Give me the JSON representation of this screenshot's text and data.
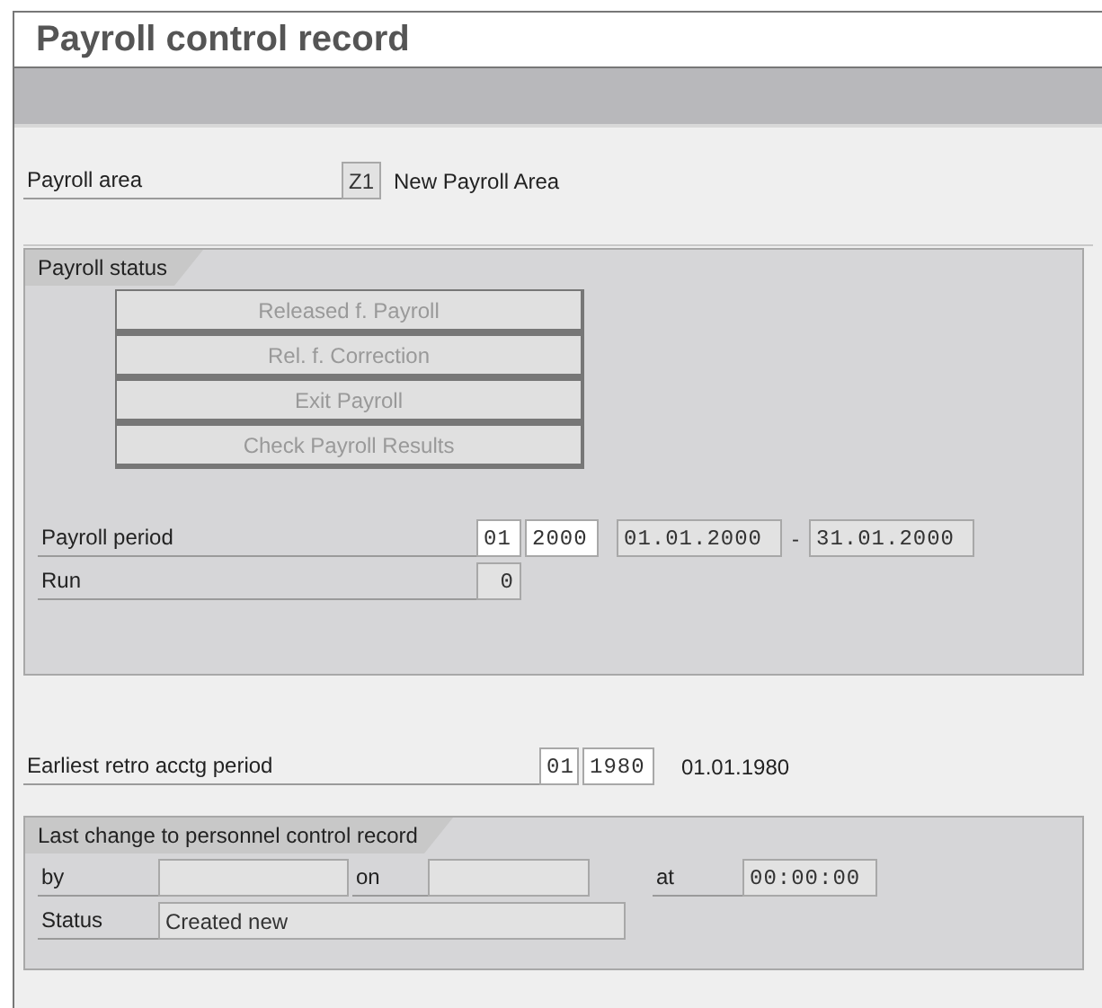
{
  "title": "Payroll control record",
  "payroll_area": {
    "label": "Payroll area",
    "code": {
      "value": "Z1",
      "editable": false
    },
    "name": "New Payroll Area"
  },
  "payroll_status": {
    "title": "Payroll status",
    "buttons": [
      {
        "label": "Released f. Payroll",
        "disabled": true
      },
      {
        "label": "Rel. f. Correction",
        "disabled": true
      },
      {
        "label": "Exit Payroll",
        "disabled": true
      },
      {
        "label": "Check Payroll Results",
        "disabled": true
      }
    ],
    "period": {
      "label": "Payroll period",
      "number": {
        "value": "01",
        "editable": true
      },
      "year": {
        "value": "2000",
        "editable": true
      },
      "start_date": {
        "value": "01.01.2000",
        "editable": false
      },
      "separator": "-",
      "end_date": {
        "value": "31.01.2000",
        "editable": false
      }
    },
    "run": {
      "label": "Run",
      "value": "0",
      "editable": false
    }
  },
  "earliest_retro": {
    "label": "Earliest retro acctg period",
    "number": {
      "value": "01",
      "editable": true
    },
    "year": {
      "value": "1980",
      "editable": true
    },
    "date": "01.01.1980"
  },
  "last_change": {
    "title": "Last change to personnel control record",
    "by": {
      "label": "by",
      "editable": false
    },
    "on": {
      "label": "on",
      "editable": false
    },
    "at": {
      "label": "at",
      "value": "00:00:00",
      "editable": false
    },
    "status": {
      "label": "Status",
      "value": "Created new",
      "editable": false
    }
  }
}
